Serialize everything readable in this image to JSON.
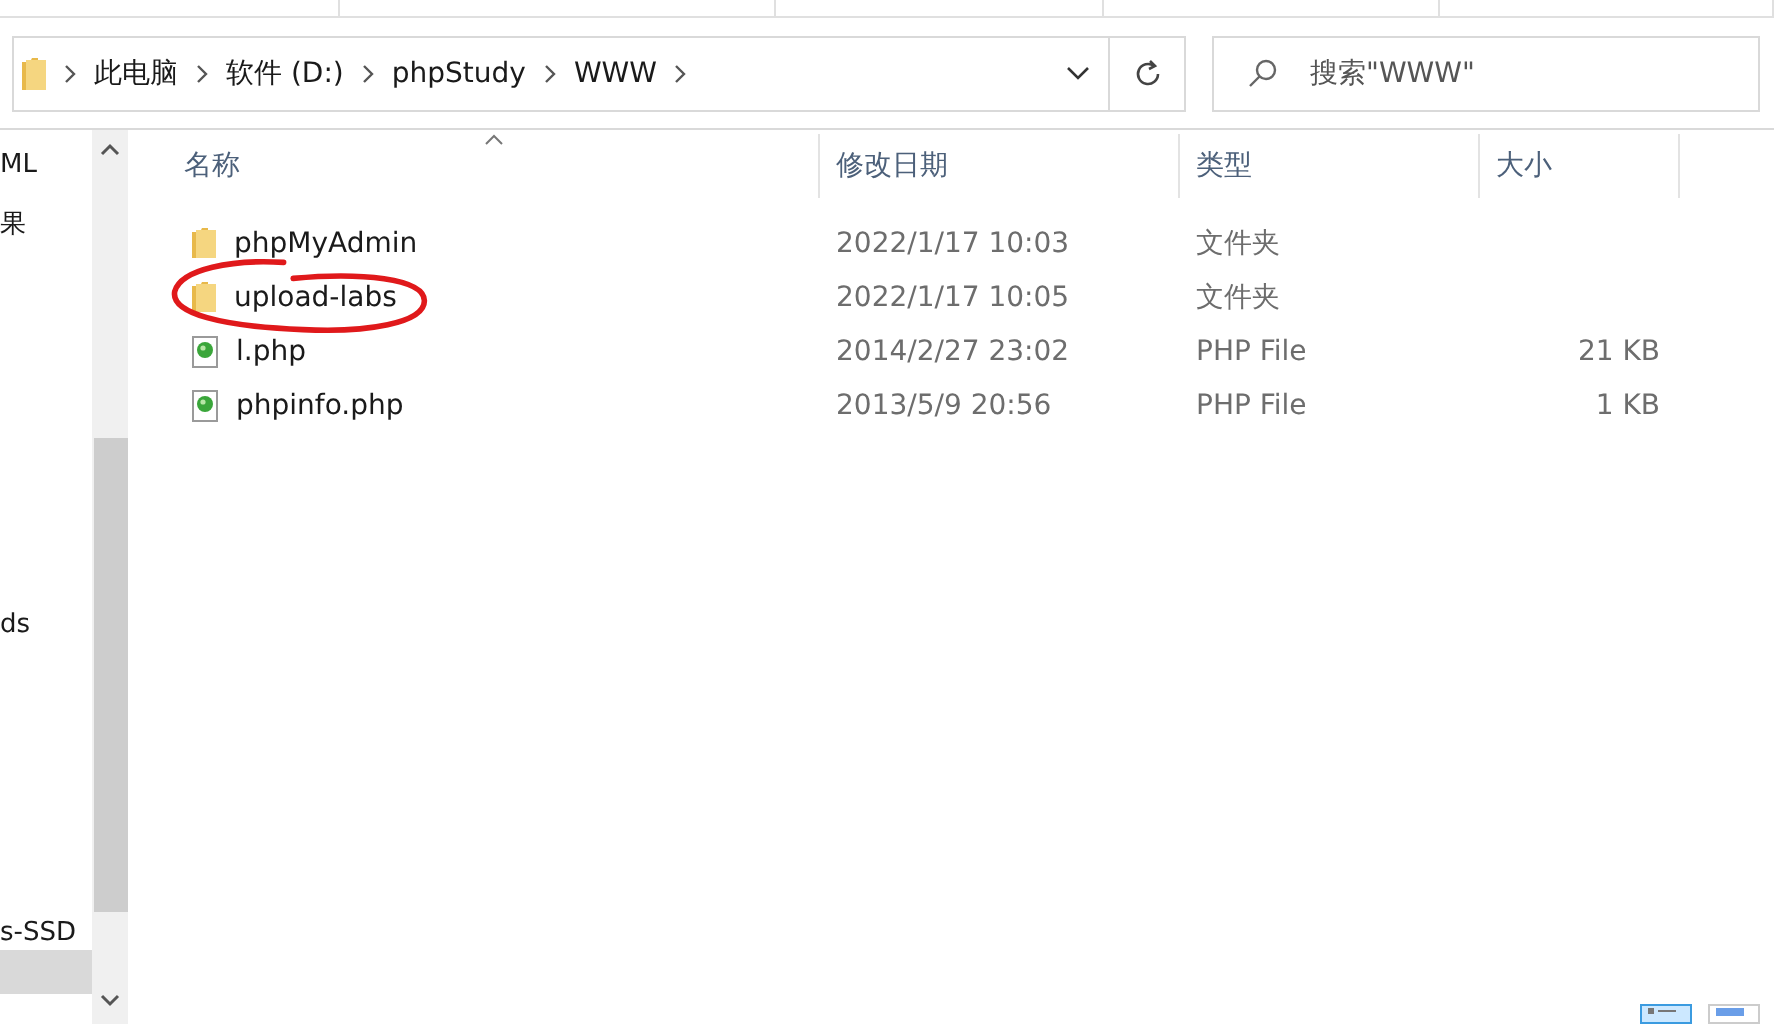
{
  "address_bar": {
    "path": [
      {
        "label": "此电脑"
      },
      {
        "label": "软件 (D:)"
      },
      {
        "label": "phpStudy"
      },
      {
        "label": "WWW"
      }
    ]
  },
  "search": {
    "placeholder": "搜索\"WWW\""
  },
  "nav_pane": {
    "items": [
      {
        "label": "ML",
        "selected": false
      },
      {
        "label": "果",
        "selected": false
      },
      {
        "label": "ds",
        "selected": false
      },
      {
        "label": "s-SSD",
        "selected": false
      },
      {
        "selected": true
      }
    ]
  },
  "table": {
    "columns": [
      {
        "label": "名称",
        "sorted": true
      },
      {
        "label": "修改日期",
        "sorted": false
      },
      {
        "label": "类型",
        "sorted": false
      },
      {
        "label": "大小",
        "sorted": false
      }
    ],
    "rows": [
      {
        "kind": "folder",
        "name": "phpMyAdmin",
        "modified": "2022/1/17 10:03",
        "type": "文件夹",
        "size": "",
        "circled": false
      },
      {
        "kind": "folder",
        "name": "upload-labs",
        "modified": "2022/1/17 10:05",
        "type": "文件夹",
        "size": "",
        "circled": true
      },
      {
        "kind": "php",
        "name": "l.php",
        "modified": "2014/2/27 23:02",
        "type": "PHP File",
        "size": "21 KB",
        "circled": false
      },
      {
        "kind": "php",
        "name": "phpinfo.php",
        "modified": "2013/5/9 20:56",
        "type": "PHP File",
        "size": "1 KB",
        "circled": false
      }
    ]
  },
  "status_bar": {
    "views": [
      {
        "kind": "details",
        "selected": true
      },
      {
        "kind": "tiles",
        "selected": false
      }
    ]
  }
}
